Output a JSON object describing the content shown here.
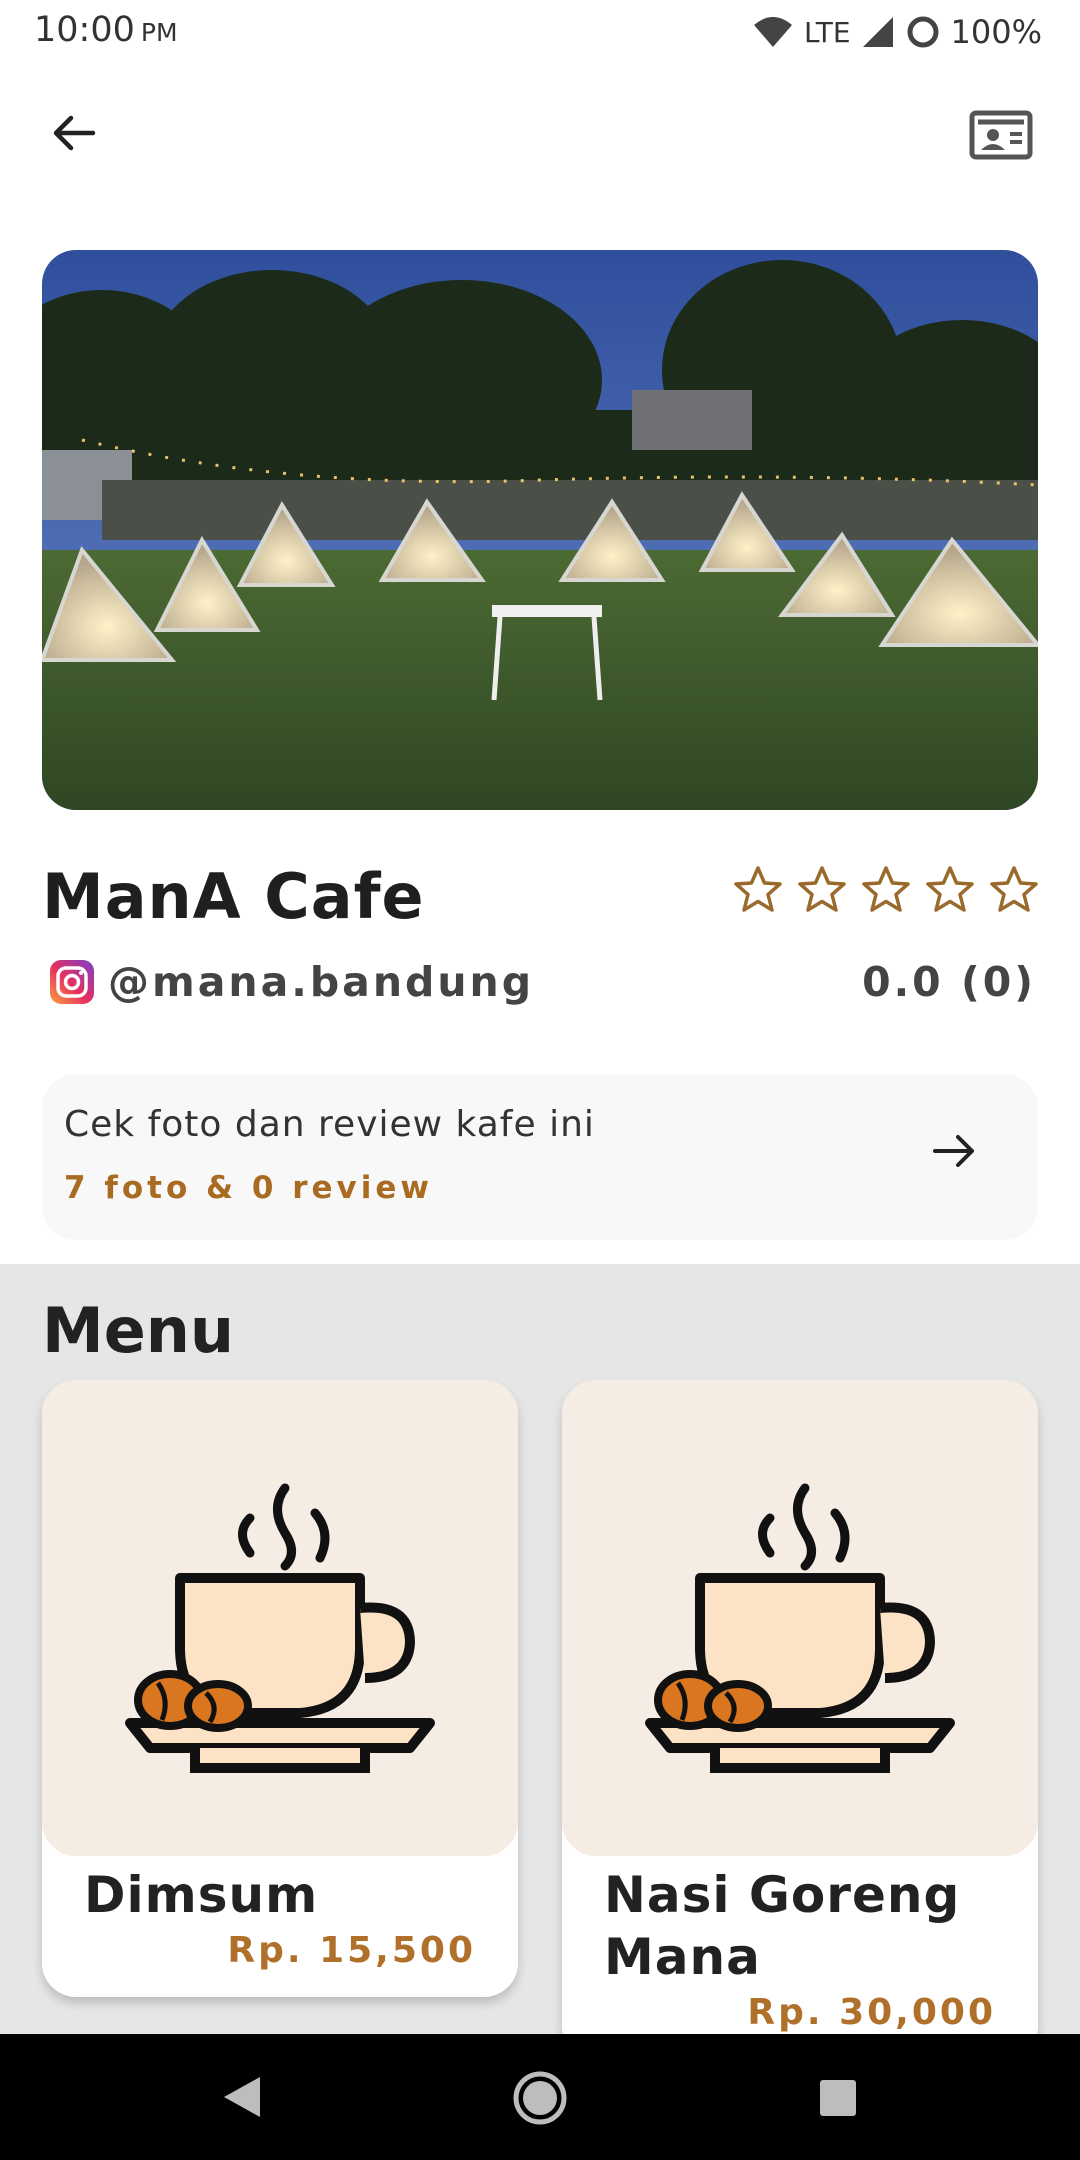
{
  "status_bar": {
    "time": "10:00",
    "ampm": "PM",
    "network": "LTE",
    "battery": "100%"
  },
  "cafe": {
    "name": "ManA Cafe",
    "instagram": "@mana.bandung",
    "rating_text": "0.0 (0)",
    "rating_value": 0,
    "stars_max": 5
  },
  "reviews": {
    "title": "Cek foto dan review kafe ini",
    "subtitle": "7 foto & 0 review"
  },
  "menu": {
    "title": "Menu",
    "items": [
      {
        "name": "Dimsum",
        "price": "Rp. 15,500"
      },
      {
        "name": "Nasi Goreng Mana",
        "price": "Rp. 30,000"
      }
    ]
  },
  "colors": {
    "accent": "#a86b21",
    "star": "#9a6a2c",
    "menu_bg": "#e6e6e6",
    "card_image_bg": "#f5ece4"
  }
}
